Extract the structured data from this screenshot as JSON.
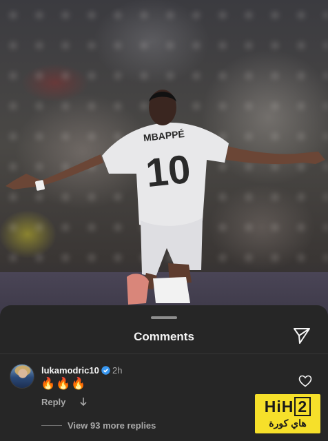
{
  "photo": {
    "jersey_name": "MBAPPÉ",
    "jersey_number": "10"
  },
  "sheet": {
    "title": "Comments",
    "title_icon": "send-icon"
  },
  "comment": {
    "username": "lukamodric10",
    "verified_icon": "verified-badge-icon",
    "time": "2h",
    "text": "🔥🔥🔥",
    "like_icon": "heart-outline-icon",
    "reply_label": "Reply",
    "reply_icon": "down-arrow-icon",
    "more_replies_label": "View 93 more replies"
  },
  "watermark": {
    "brand_prefix": "HiH",
    "brand_digit": "2",
    "brand_arabic": "هاي كورة",
    "color": "#f6e02a"
  },
  "colors": {
    "sheet_bg": "#262626",
    "text_primary": "#f5f5f5",
    "text_secondary": "#a8a8a8",
    "verified_blue": "#3897f0"
  }
}
